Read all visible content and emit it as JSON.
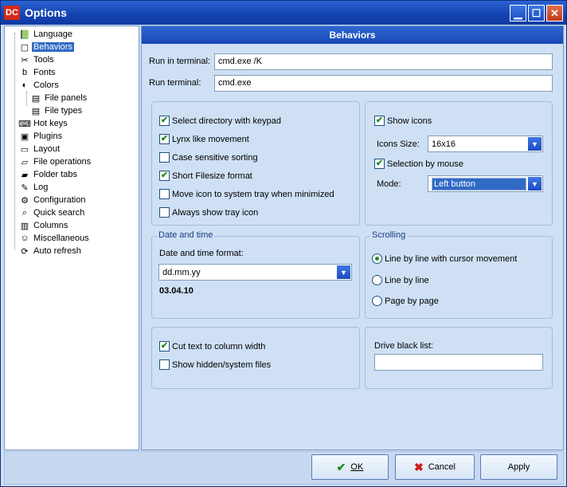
{
  "window": {
    "title": "Options",
    "app_icon": "DC"
  },
  "tree": {
    "items": [
      {
        "label": "Language",
        "icon": "📗",
        "level": 0
      },
      {
        "label": "Behaviors",
        "icon": "▢",
        "level": 0,
        "selected": true
      },
      {
        "label": "Tools",
        "icon": "✂",
        "level": 0
      },
      {
        "label": "Fonts",
        "icon": "b",
        "level": 0
      },
      {
        "label": "Colors",
        "icon": "◐",
        "level": 0
      },
      {
        "label": "File panels",
        "icon": "▤",
        "level": 1
      },
      {
        "label": "File types",
        "icon": "▤",
        "level": 1
      },
      {
        "label": "Hot keys",
        "icon": "⌨",
        "level": 0
      },
      {
        "label": "Plugins",
        "icon": "▣",
        "level": 0
      },
      {
        "label": "Layout",
        "icon": "▭",
        "level": 0
      },
      {
        "label": "File operations",
        "icon": "▱",
        "level": 0
      },
      {
        "label": "Folder tabs",
        "icon": "▰",
        "level": 0
      },
      {
        "label": "Log",
        "icon": "✎",
        "level": 0
      },
      {
        "label": "Configuration",
        "icon": "⚙",
        "level": 0
      },
      {
        "label": "Quick search",
        "icon": "⌕",
        "level": 0
      },
      {
        "label": "Columns",
        "icon": "▥",
        "level": 0
      },
      {
        "label": "Miscellaneous",
        "icon": "☺",
        "level": 0
      },
      {
        "label": "Auto refresh",
        "icon": "⟳",
        "level": 0
      }
    ]
  },
  "panel": {
    "header": "Behaviors",
    "run_in_terminal_label": "Run in terminal:",
    "run_in_terminal_value": "cmd.exe /K",
    "run_terminal_label": "Run terminal:",
    "run_terminal_value": "cmd.exe",
    "general_checks": [
      {
        "label": "Select directory with keypad",
        "checked": true
      },
      {
        "label": "Lynx like movement",
        "checked": true
      },
      {
        "label": "Case sensitive sorting",
        "checked": false
      },
      {
        "label": "Short Filesize format",
        "checked": true
      },
      {
        "label": "Move icon to system tray when minimized",
        "checked": false
      },
      {
        "label": "Always show tray icon",
        "checked": false
      }
    ],
    "icons": {
      "show_icons_label": "Show icons",
      "show_icons_checked": true,
      "icons_size_label": "Icons Size:",
      "icons_size_value": "16x16",
      "selection_by_mouse_label": "Selection by mouse",
      "selection_by_mouse_checked": true,
      "mode_label": "Mode:",
      "mode_value": "Left button"
    },
    "date_time": {
      "group_title": "Date and time",
      "format_label": "Date and time format:",
      "format_value": "dd.mm.yy",
      "preview": "03.04.10"
    },
    "scrolling": {
      "group_title": "Scrolling",
      "options": [
        {
          "label": "Line by line with cursor movement",
          "selected": true
        },
        {
          "label": "Line by line",
          "selected": false
        },
        {
          "label": "Page by page",
          "selected": false
        }
      ]
    },
    "misc_checks": [
      {
        "label": "Cut text to column width",
        "checked": true
      },
      {
        "label": "Show hidden/system files",
        "checked": false
      }
    ],
    "drive_black_list_label": "Drive black list:",
    "drive_black_list_value": ""
  },
  "buttons": {
    "ok": "OK",
    "cancel": "Cancel",
    "apply": "Apply"
  },
  "colors": {
    "accent": "#316ac5",
    "check": "#1f8a1f",
    "cancel_x": "#d21a1a"
  }
}
